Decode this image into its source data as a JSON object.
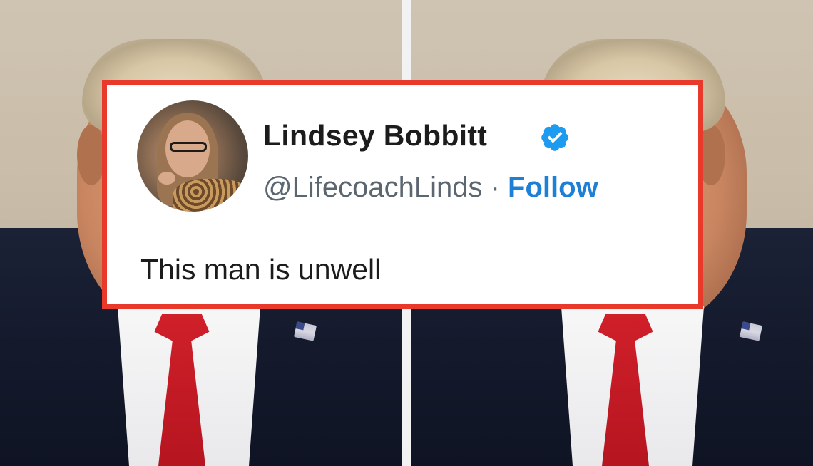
{
  "tweet": {
    "name": "Lindsey Bobbitt",
    "handle": "@LifecoachLinds",
    "separator": "·",
    "follow_label": "Follow",
    "text": "This man is unwell",
    "verified_icon": "verified-badge-icon"
  },
  "colors": {
    "card_border": "#e8392b",
    "follow": "#1d7fd6",
    "verified": "#1d9bf0"
  }
}
